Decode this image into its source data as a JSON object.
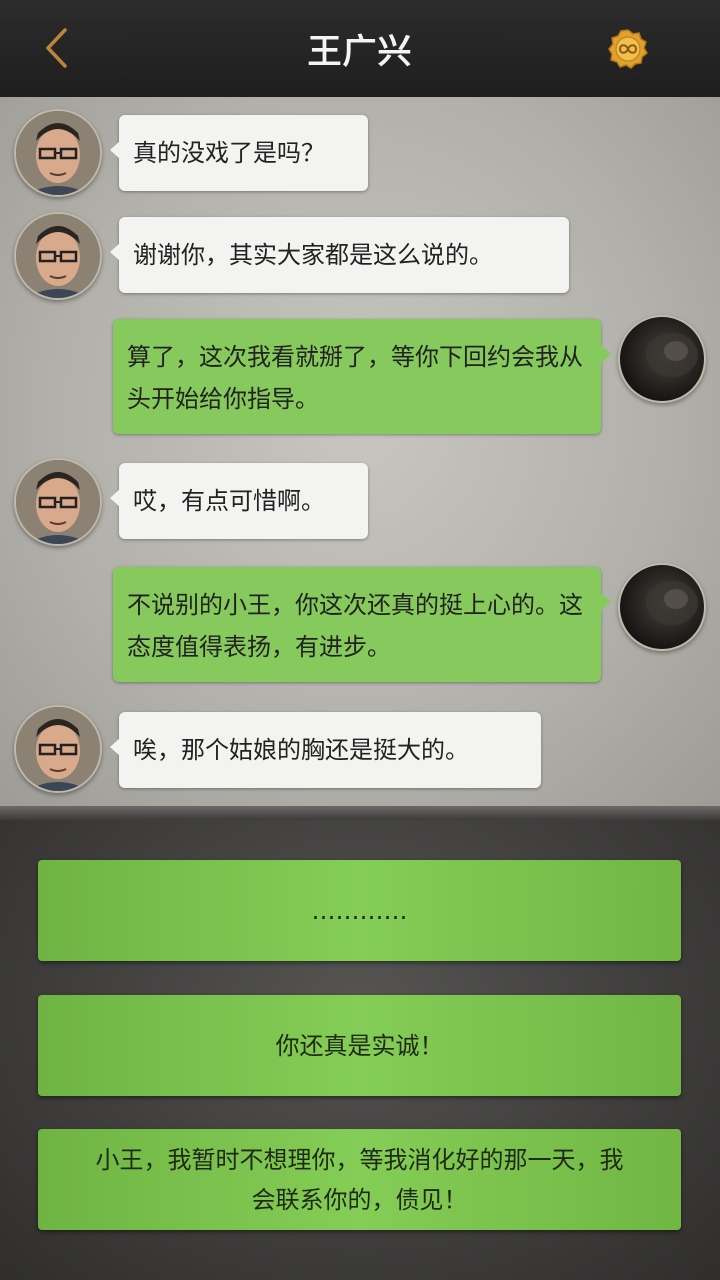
{
  "header": {
    "title": "王广兴",
    "back_icon": "chevron-left-icon",
    "badge_icon": "infinity-coin-icon"
  },
  "messages": [
    {
      "side": "left",
      "text": "真的没戏了是吗？"
    },
    {
      "side": "left",
      "text": "谢谢你，其实大家都是这么说的。"
    },
    {
      "side": "right",
      "text": "算了，这次我看就掰了，等你下回约会我从头开始给你指导。"
    },
    {
      "side": "left",
      "text": "哎，有点可惜啊。"
    },
    {
      "side": "right",
      "text": "不说别的小王，你这次还真的挺上心的。这态度值得表扬，有进步。"
    },
    {
      "side": "left",
      "text": "唉，那个姑娘的胸还是挺大的。"
    }
  ],
  "options": [
    {
      "text": "…………"
    },
    {
      "text": "你还真是实诚！"
    },
    {
      "text": "小王，我暂时不想理你，等我消化好的那一天，我会联系你的，债见！"
    }
  ],
  "colors": {
    "header_bg": "#232323",
    "bubble_left": "#f3f3f1",
    "bubble_right": "#86c95c",
    "option_green": "#84cd56",
    "accent_gold": "#e2a72f"
  }
}
